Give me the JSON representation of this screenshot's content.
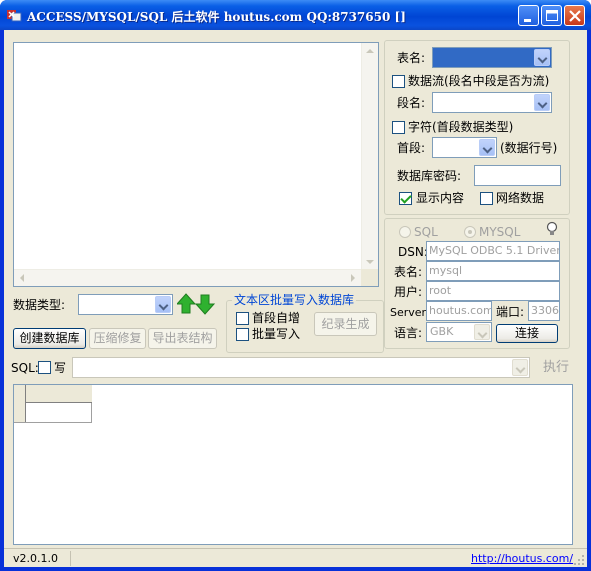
{
  "window": {
    "title": "ACCESS/MYSQL/SQL 后土软件 houtus.com QQ:8737650 []"
  },
  "text_area": {
    "value": ""
  },
  "left_controls": {
    "db_type_label": "数据类型:",
    "db_type_value": "",
    "buttons": {
      "create_db": "创建数据库",
      "compact_repair": "压缩修复",
      "export_structure": "导出表结构"
    }
  },
  "batch_group": {
    "title": "文本区批量写入数据库",
    "first_field_auto_inc": "首段自增",
    "batch_write": "批量写入",
    "generate_record": "纪录生成"
  },
  "right_top": {
    "table_name_label": "表名:",
    "table_name_value": "",
    "data_stream_label": "数据流(段名中段是否为流)",
    "field_name_label": "段名:",
    "field_name_value": "",
    "char_label": "字符(首段数据类型)",
    "first_field_label": "首段:",
    "first_field_value": "",
    "row_number_label": "(数据行号)",
    "db_password_label": "数据库密码:",
    "db_password_value": "",
    "show_content_label": "显示内容",
    "network_data_label": "网络数据"
  },
  "right_bottom": {
    "radio_sql": "SQL",
    "radio_mysql": "MYSQL",
    "dsn_label": "DSN:",
    "dsn_value": "MySQL ODBC 5.1 Driver",
    "table_label": "表名:",
    "table_value": "mysql",
    "user_label": "用户:",
    "user_value": "root",
    "server_label": "Server:",
    "server_value": "houtus.com",
    "port_label": "端口:",
    "port_value": "3306",
    "language_label": "语言:",
    "language_value": "GBK",
    "connect_button": "连接"
  },
  "sql_bar": {
    "sql_label": "SQL:",
    "write_label": "写",
    "sql_value": "",
    "execute_button": "执行"
  },
  "status": {
    "version": "v2.0.1.0",
    "url": "http://houtus.com/"
  }
}
